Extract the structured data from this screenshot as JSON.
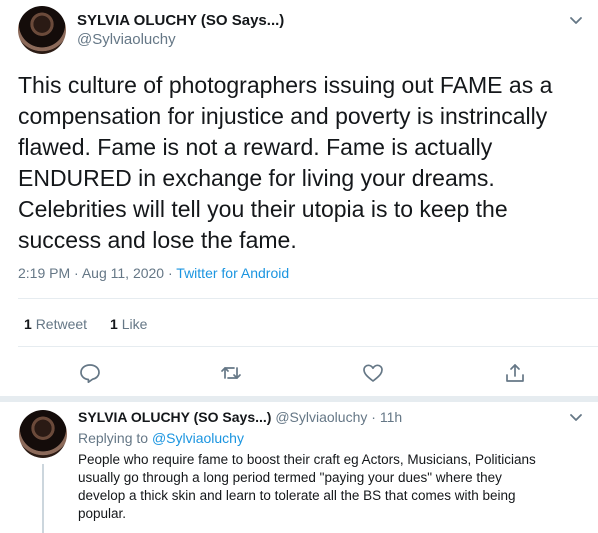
{
  "tweet": {
    "author_name": "SYLVIA OLUCHY (SO Says...)",
    "author_handle": "@Sylviaoluchy",
    "text_lines": [
      "This culture of photographers issuing out FAME as a",
      "compensation for injustice and poverty is instrincally",
      "flawed. Fame is not a reward. Fame is actually",
      "ENDURED in exchange for living your dreams.",
      "Celebrities will tell you their utopia is to keep the",
      "success and lose the fame."
    ],
    "time": "2:19 PM",
    "separator": "·",
    "date": "Aug 11, 2020",
    "source": "Twitter for Android",
    "retweets_count": "1",
    "retweets_label": "Retweet",
    "likes_count": "1",
    "likes_label": "Like"
  },
  "actions": {
    "reply_icon": "reply-icon",
    "retweet_icon": "retweet-icon",
    "like_icon": "heart-icon",
    "share_icon": "share-icon"
  },
  "reply": {
    "author_name": "SYLVIA OLUCHY (SO Says...)",
    "author_handle": "@Sylviaoluchy",
    "separator": "·",
    "age": "11h",
    "replying_prefix": "Replying to",
    "replying_handle": "@Sylviaoluchy",
    "text_lines": [
      "People who require fame to boost their craft eg Actors, Musicians, Politicians",
      "usually go through a long period termed \"paying your dues\" where they",
      "develop a thick skin and learn to tolerate all the BS that comes with being",
      "popular."
    ]
  },
  "colors": {
    "link": "#1b95e0",
    "muted": "#657786",
    "text": "#14171a"
  }
}
